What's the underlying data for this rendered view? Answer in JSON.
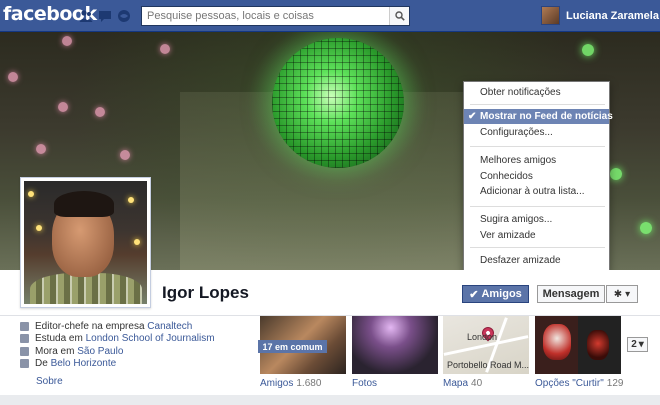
{
  "topbar": {
    "logo": "facebook",
    "search_placeholder": "Pesquise pessoas, locais e coisas",
    "user_name": "Luciana Zaramela",
    "jewels": [
      "friend-requests-icon",
      "messages-icon",
      "notifications-icon"
    ]
  },
  "profile": {
    "name": "Igor Lopes",
    "friends_button": "Amigos",
    "message_button": "Mensagem"
  },
  "menu": {
    "items": [
      {
        "label": "Obter notificações",
        "selected": false
      },
      {
        "label": "Mostrar no Feed de notícias",
        "selected": true
      },
      {
        "label": "Configurações...",
        "selected": false
      },
      {
        "label": "Melhores amigos",
        "selected": false
      },
      {
        "label": "Conhecidos",
        "selected": false
      },
      {
        "label": "Adicionar à outra lista...",
        "selected": false
      },
      {
        "label": "Sugira amigos...",
        "selected": false
      },
      {
        "label": "Ver amizade",
        "selected": false
      },
      {
        "label": "Desfazer amizade",
        "selected": false
      }
    ]
  },
  "about": {
    "work_prefix": "Editor-chefe na empresa ",
    "work_link": "Canaltech",
    "study_prefix": "Estuda em ",
    "study_link": "London School of Journalism",
    "lives_prefix": "Mora em ",
    "lives_link": "São Paulo",
    "from_prefix": "De ",
    "from_link": "Belo Horizonte",
    "more": "Sobre"
  },
  "tiles": {
    "friends": {
      "label": "Amigos",
      "count": "1.680",
      "badge": "17 em comum"
    },
    "photos": {
      "label": "Fotos"
    },
    "map": {
      "label": "Mapa",
      "count": "40",
      "place1": "London",
      "place2": "Portobello Road M..."
    },
    "likes": {
      "label": "Opções \"Curtir\"",
      "count": "129"
    },
    "pager": "2"
  },
  "colors": {
    "brand": "#3b5998",
    "selected_menu": "#6d84b4",
    "friends_button": "#5b74a8"
  }
}
